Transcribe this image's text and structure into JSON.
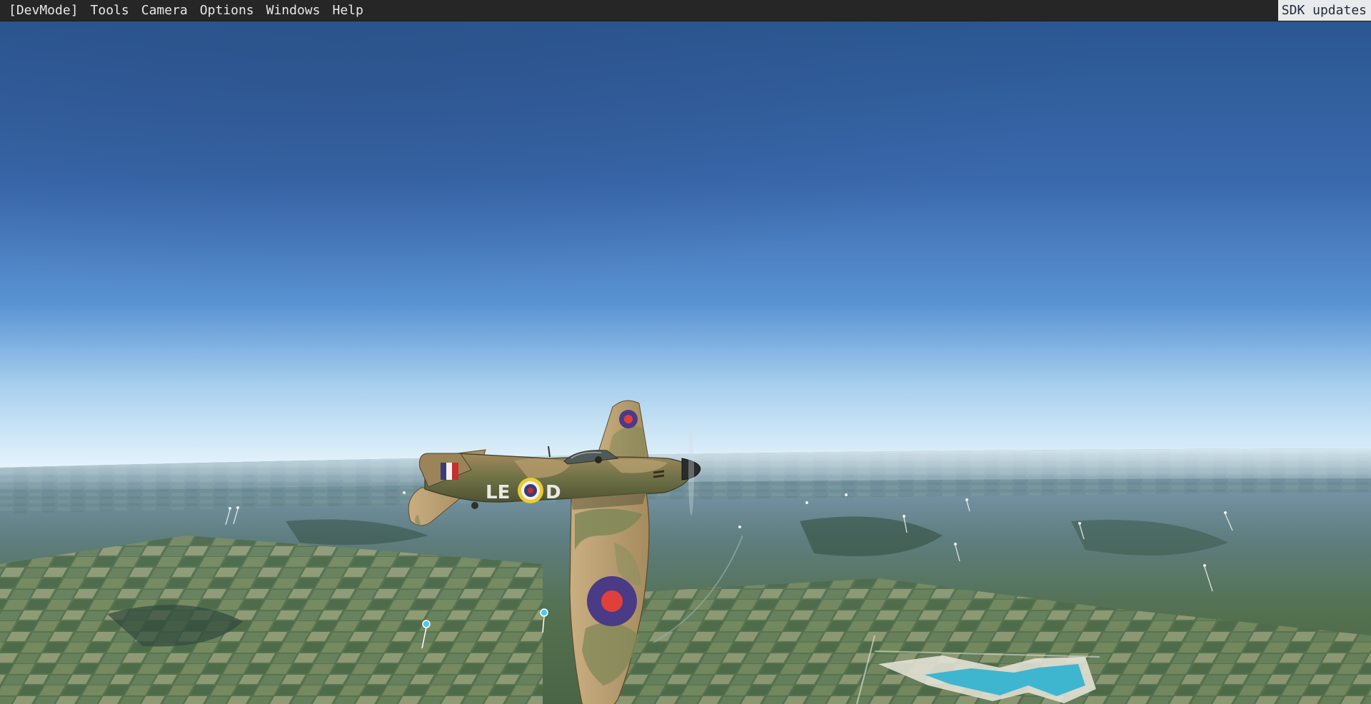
{
  "menubar": {
    "items": [
      {
        "label": "[DevMode]",
        "name": "menu-devmode"
      },
      {
        "label": "Tools",
        "name": "menu-tools"
      },
      {
        "label": "Camera",
        "name": "menu-camera"
      },
      {
        "label": "Options",
        "name": "menu-options"
      },
      {
        "label": "Windows",
        "name": "menu-windows"
      },
      {
        "label": "Help",
        "name": "menu-help"
      }
    ],
    "sdk_updates_label": "SDK updates"
  },
  "scene": {
    "aircraft_code_left": "LE",
    "aircraft_code_right": "D",
    "colors": {
      "sky_top": "#2d5590",
      "sky_mid": "#4d82c8",
      "horizon": "#e6f2fa",
      "ground_far": "#6e8fa6",
      "ground_near": "#4d6a4a",
      "camo_brown": "#b49a6a",
      "camo_green": "#7f8758",
      "roundel_blue": "#4b3a86",
      "roundel_red": "#e0403c",
      "roundel_yellow": "#e8cc34",
      "lake": "#3fb6cf"
    }
  }
}
